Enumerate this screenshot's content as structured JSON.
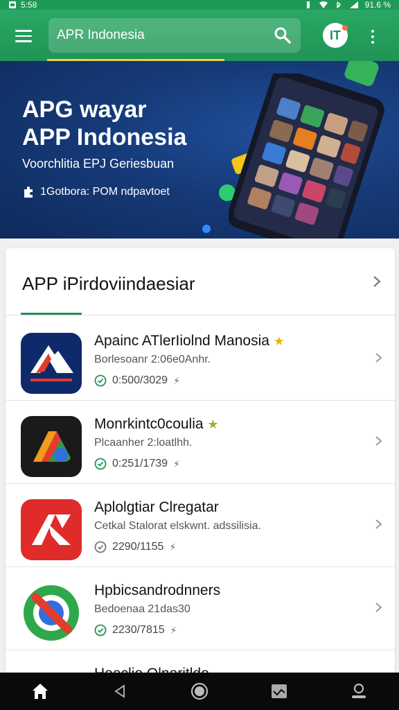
{
  "status_bar": {
    "time": "5:58",
    "battery": "91.6 %"
  },
  "app_bar": {
    "search_text": "APR Indonesia",
    "avatar_letter": "IT"
  },
  "banner": {
    "title_line1": "APG wayar",
    "title_line2": "APP Indonesia",
    "subtitle": "Voorchlitia EPJ Geriesbuan",
    "meta": "1Gotbora:  POM ndpavtoet"
  },
  "section": {
    "title": "APP iPirdoviindaesiar"
  },
  "apps": [
    {
      "name": "Apainc ATlerIiolnd Manosia",
      "badge": "★",
      "desc": "Borlesoanr 2:06e0Anhr.",
      "meta": "0:500/3029",
      "verified": true,
      "icon": "red-blue-a-logo-icon"
    },
    {
      "name": "Monrkintc0coulia",
      "badge": "★",
      "desc": "Plcaanher 2:loatlhh.",
      "meta": "0:251/1739",
      "verified": true,
      "icon": "multicolor-a-logo-icon"
    },
    {
      "name": "Aplolgtiar Clregatar",
      "badge": "",
      "desc": "Cetkal Stalorat elskwnt. adssilisia.",
      "meta": "2290/1155",
      "verified": false,
      "icon": "red-a-logo-icon"
    },
    {
      "name": "Hpbicsandrodnners",
      "badge": "",
      "desc": "Bedoenaa 21das30",
      "meta": "2230/7815",
      "verified": true,
      "icon": "green-circle-logo-icon"
    },
    {
      "name": "Hoeclio Qlnoritldo",
      "badge": "",
      "desc": "",
      "meta": "",
      "verified": false,
      "icon": "orange-logo-icon"
    }
  ],
  "colors": {
    "primary_green": "#1f9456",
    "banner_blue": "#163a78",
    "accent_yellow": "#e8d54a",
    "nav_black": "#0a0a0a"
  }
}
